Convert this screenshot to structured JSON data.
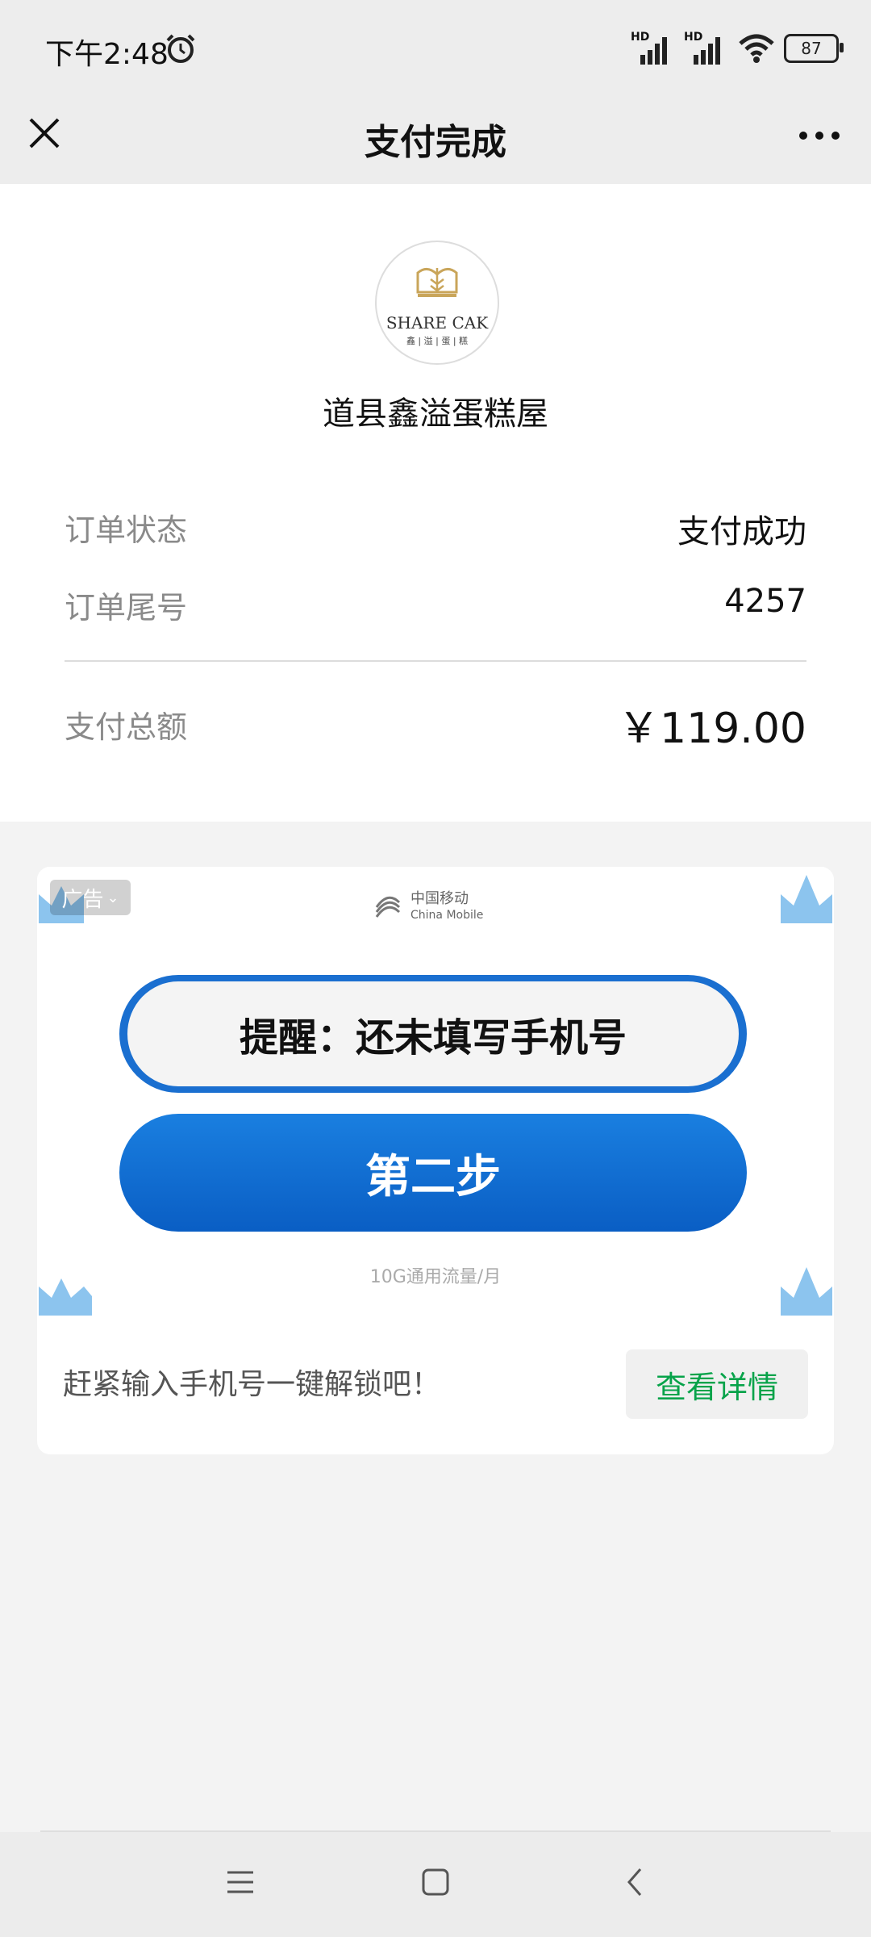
{
  "status_bar": {
    "time": "下午2:48",
    "battery": "87",
    "network_1": "HD",
    "network_2": "HD"
  },
  "nav": {
    "title": "支付完成"
  },
  "merchant": {
    "logo_text": "SHARE CAK",
    "logo_sub": "鑫 | 溢 | 蛋 | 糕",
    "name": "道县鑫溢蛋糕屋"
  },
  "order": {
    "status_label": "订单状态",
    "status_value": "支付成功",
    "tail_label": "订单尾号",
    "tail_value": "4257",
    "total_label": "支付总额",
    "total_value": "￥119.00"
  },
  "ad": {
    "badge": "广告",
    "sponsor_cn": "中国移动",
    "sponsor_en": "China Mobile",
    "reminder": "提醒：还未填写手机号",
    "step_button": "第二步",
    "footnote": "10G通用流量/月",
    "description": "赶紧输入手机号一键解锁吧！",
    "details_button": "查看详情"
  },
  "colors": {
    "accent_green": "#07a34a",
    "ad_blue": "#1a6fd0"
  }
}
